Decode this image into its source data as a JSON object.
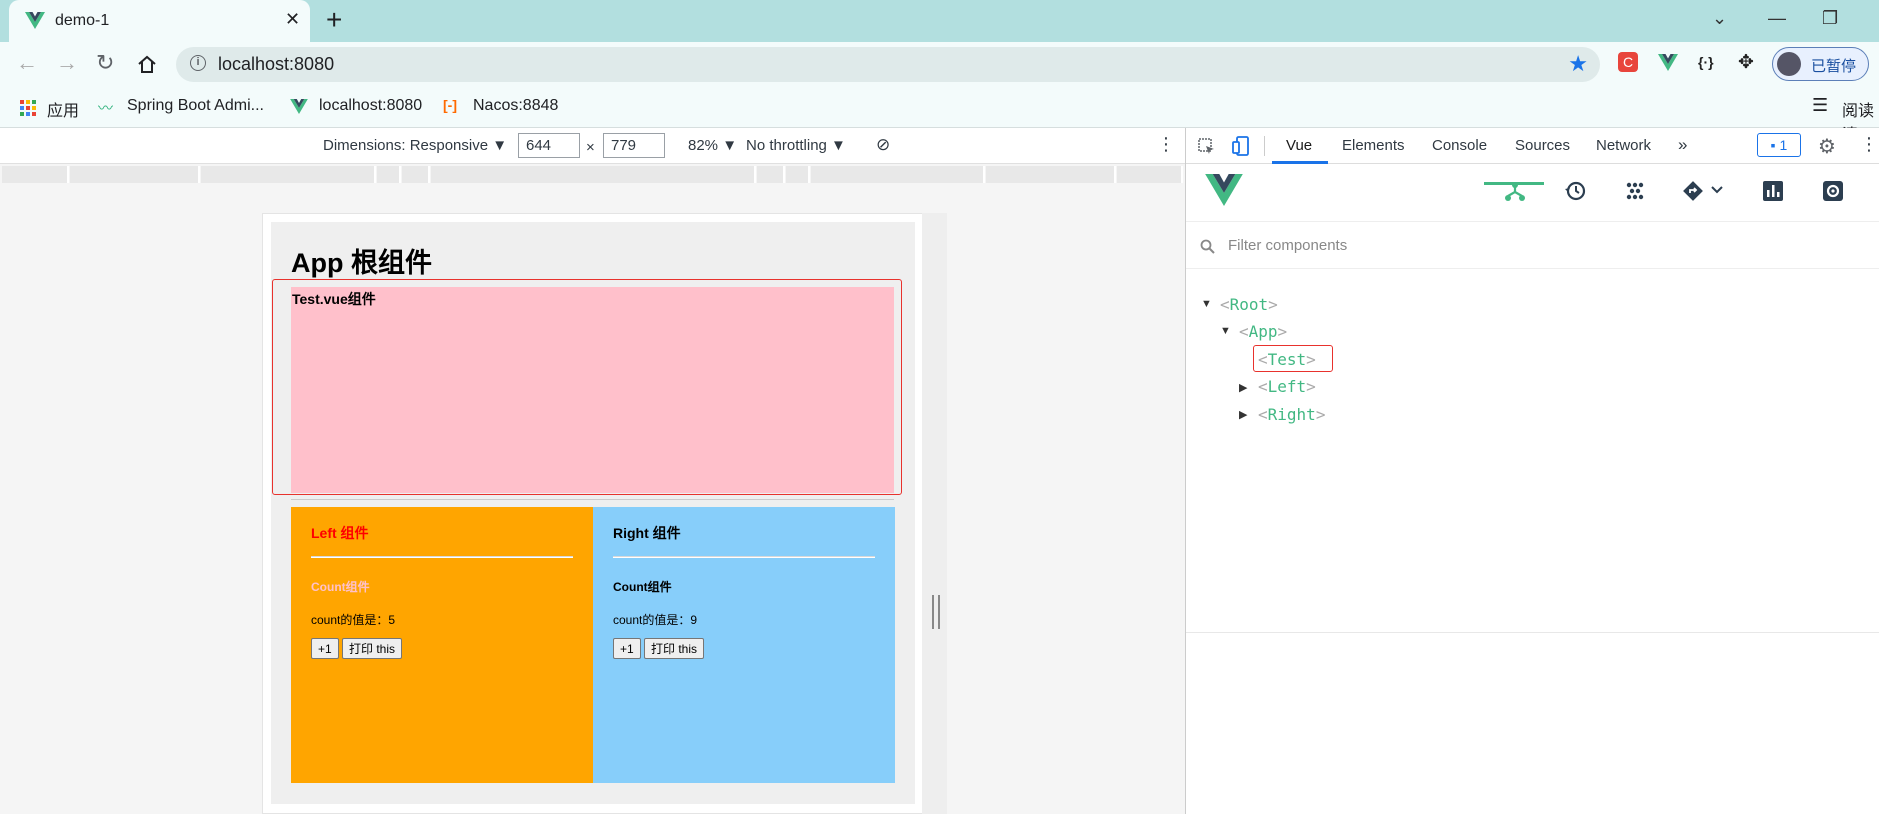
{
  "browser": {
    "tab_title": "demo-1",
    "tab_close": "✕",
    "new_tab": "+",
    "url": "localhost:8080",
    "profile_label": "已暂停",
    "reading_label": "阅读清",
    "window_controls": {
      "dropdown": "⌄",
      "minimize": "—",
      "restore": "❐"
    },
    "ext_json": "{·}"
  },
  "bookmarks": [
    {
      "label": "应用"
    },
    {
      "label": "Spring Boot Admi..."
    },
    {
      "label": "localhost:8080"
    },
    {
      "label": "Nacos:8848"
    }
  ],
  "device_toolbar": {
    "dimensions": "Dimensions: Responsive ▼",
    "width": "644",
    "height": "779",
    "times": "×",
    "zoom": "82% ▼",
    "throttling": "No throttling ▼",
    "more": "⋮"
  },
  "page": {
    "app_title": "App 根组件",
    "test_label": "Test.vue组件",
    "left": {
      "title": "Left 组件",
      "count_title": "Count组件",
      "count_value": "count的值是：5",
      "btn_inc": "+1",
      "btn_print": "打印 this"
    },
    "right": {
      "title": "Right 组件",
      "count_title": "Count组件",
      "count_value": "count的值是：9",
      "btn_inc": "+1",
      "btn_print": "打印 this"
    }
  },
  "devtools": {
    "tabs": [
      "Vue",
      "Elements",
      "Console",
      "Sources",
      "Network"
    ],
    "more_tabs": "»",
    "messages": "1",
    "filter_placeholder": "Filter components",
    "tree": [
      {
        "name": "Root",
        "level": 0,
        "expanded": true
      },
      {
        "name": "App",
        "level": 1,
        "expanded": true
      },
      {
        "name": "Test",
        "level": 2,
        "leaf": true,
        "selected": true
      },
      {
        "name": "Left",
        "level": 2,
        "expanded": false
      },
      {
        "name": "Right",
        "level": 2,
        "expanded": false
      }
    ],
    "vue_toolbar_icons": [
      "components-icon",
      "timeline-icon",
      "plugins-icon",
      "router-icon",
      "performance-icon",
      "settings-icon"
    ]
  },
  "colors": {
    "vue_green": "#42b883",
    "test_bg": "#ffc0cb",
    "left_bg": "#ffa500",
    "right_bg": "#87cefa",
    "left_title": "#ff0000",
    "left_count_title": "#ffc0cb",
    "highlight_outline": "#e8322d"
  }
}
